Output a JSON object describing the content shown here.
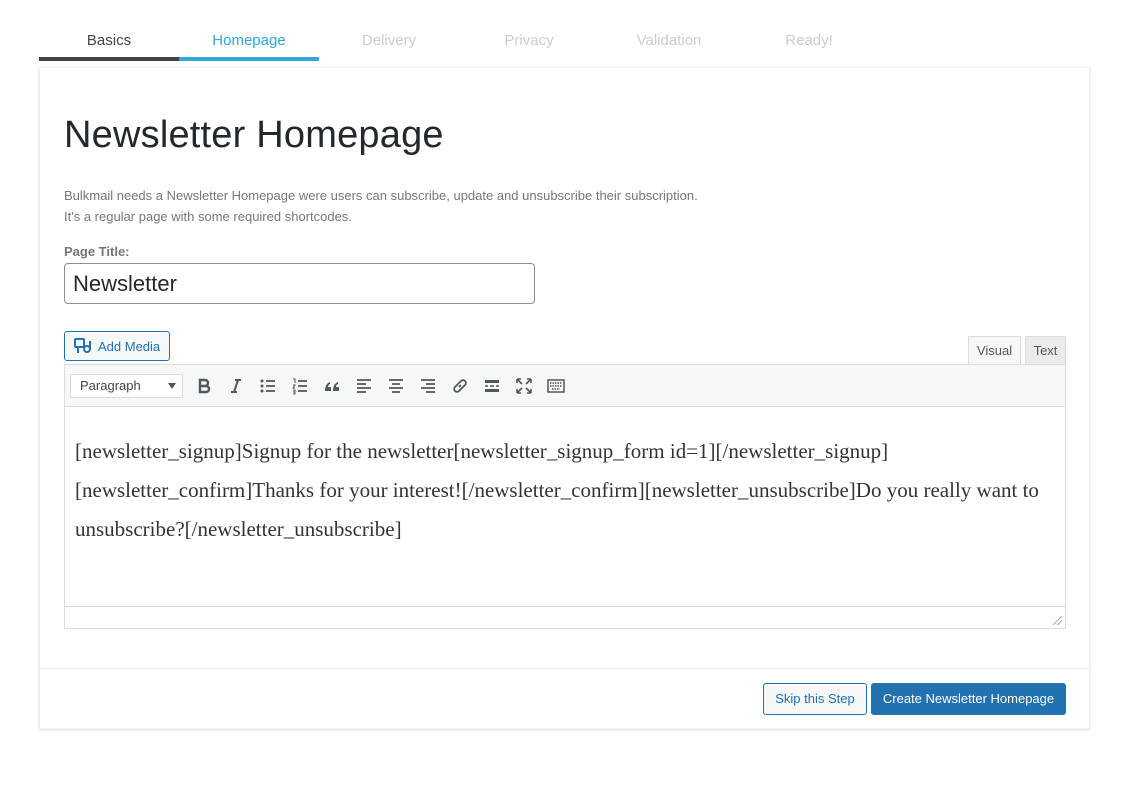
{
  "steps": [
    {
      "label": "Basics",
      "state": "done"
    },
    {
      "label": "Homepage",
      "state": "active"
    },
    {
      "label": "Delivery",
      "state": "pending"
    },
    {
      "label": "Privacy",
      "state": "pending"
    },
    {
      "label": "Validation",
      "state": "pending"
    },
    {
      "label": "Ready!",
      "state": "pending"
    }
  ],
  "page": {
    "title": "Newsletter Homepage",
    "description_line1": "Bulkmail needs a Newsletter Homepage were users can subscribe, update and unsubscribe their subscription.",
    "description_line2": "It's a regular page with some required shortcodes.",
    "page_title_label": "Page Title:",
    "page_title_value": "Newsletter"
  },
  "editor": {
    "add_media_label": "Add Media",
    "tab_visual": "Visual",
    "tab_text": "Text",
    "format_selected": "Paragraph",
    "toolbar_icons": [
      "bold-icon",
      "italic-icon",
      "bullet-list-icon",
      "numbered-list-icon",
      "blockquote-icon",
      "align-left-icon",
      "align-center-icon",
      "align-right-icon",
      "link-icon",
      "read-more-icon",
      "fullscreen-icon",
      "toolbar-toggle-icon"
    ],
    "content": "[newsletter_signup]Signup for the newsletter[newsletter_signup_form id=1][/newsletter_signup][newsletter_confirm]Thanks for your interest![/newsletter_confirm][newsletter_unsubscribe]Do you really want to unsubscribe?[/newsletter_unsubscribe]"
  },
  "footer": {
    "skip_label": "Skip this Step",
    "create_label": "Create Newsletter Homepage"
  },
  "colors": {
    "accent": "#32a6dd",
    "primary_button": "#2271b1",
    "done_step": "#444444",
    "pending_step": "#cccccc"
  }
}
